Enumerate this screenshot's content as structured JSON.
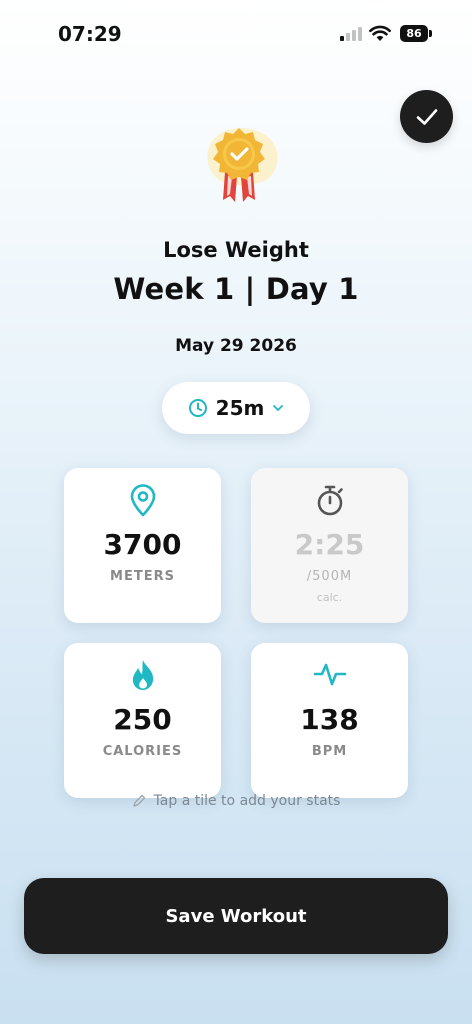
{
  "status_bar": {
    "time": "07:29",
    "battery": "86"
  },
  "header": {
    "program": "Lose Weight",
    "week_day": "Week 1 | Day 1",
    "date": "May 29 2026",
    "badge_icon": "award-ribbon-icon",
    "done_icon": "checkmark-icon"
  },
  "duration": {
    "value": "25m",
    "icon": "clock-icon",
    "dropdown_icon": "chevron-down-icon"
  },
  "tiles": [
    {
      "icon": "location-pin-icon",
      "value": "3700",
      "unit": "METERS"
    },
    {
      "icon": "stopwatch-icon",
      "value": "2:25",
      "unit": "/500M",
      "note": "calc."
    },
    {
      "icon": "flame-icon",
      "value": "250",
      "unit": "CALORIES"
    },
    {
      "icon": "heart-rate-icon",
      "value": "138",
      "unit": "BPM"
    }
  ],
  "hint": "Tap a tile to add your stats",
  "save_label": "Save Workout",
  "colors": {
    "accent": "#1fb8c4",
    "dark": "#1f1e1f",
    "badge_gold": "#f2b637",
    "ribbon_red": "#e0443a"
  }
}
